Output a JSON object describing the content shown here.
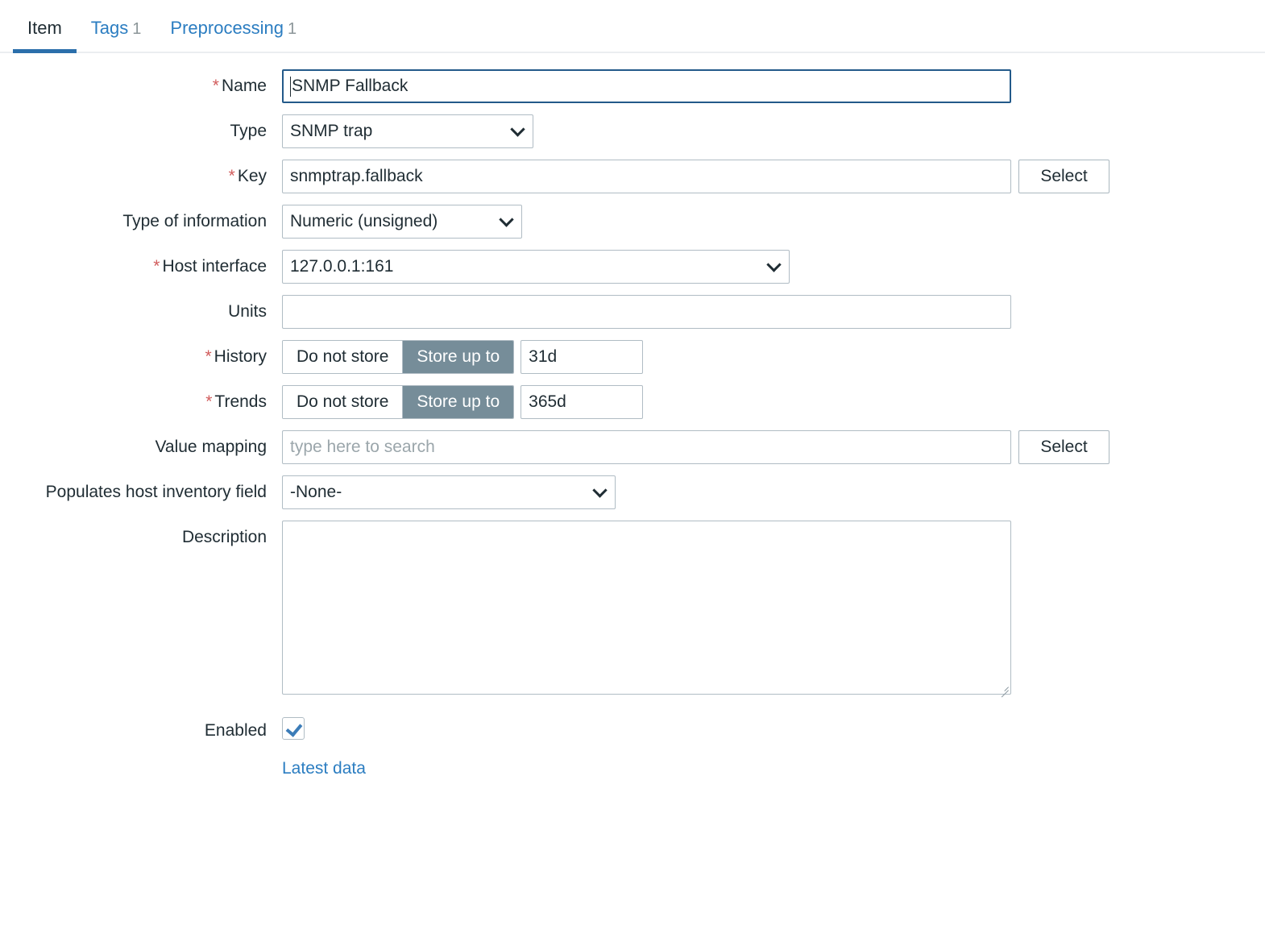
{
  "tabs": [
    {
      "label": "Item",
      "count": "",
      "active": true
    },
    {
      "label": "Tags",
      "count": "1",
      "active": false
    },
    {
      "label": "Preprocessing",
      "count": "1",
      "active": false
    }
  ],
  "form": {
    "name": {
      "label": "Name",
      "required": "*",
      "value": "SNMP Fallback",
      "focused": true
    },
    "type": {
      "label": "Type",
      "value": "SNMP trap"
    },
    "key": {
      "label": "Key",
      "required": "*",
      "value": "snmptrap.fallback",
      "select_label": "Select"
    },
    "type_of_information": {
      "label": "Type of information",
      "value": "Numeric (unsigned)"
    },
    "host_interface": {
      "label": "Host interface",
      "required": "*",
      "value": "127.0.0.1:161"
    },
    "units": {
      "label": "Units",
      "value": ""
    },
    "history": {
      "label": "History",
      "required": "*",
      "opt_off": "Do not store",
      "opt_on": "Store up to",
      "selected": "Store up to",
      "value": "31d"
    },
    "trends": {
      "label": "Trends",
      "required": "*",
      "opt_off": "Do not store",
      "opt_on": "Store up to",
      "selected": "Store up to",
      "value": "365d"
    },
    "value_mapping": {
      "label": "Value mapping",
      "value": "",
      "placeholder": "type here to search",
      "select_label": "Select"
    },
    "inventory_field": {
      "label": "Populates host inventory field",
      "value": "-None-"
    },
    "description": {
      "label": "Description",
      "value": ""
    },
    "enabled": {
      "label": "Enabled",
      "checked": true
    },
    "latest_data_link": "Latest data"
  },
  "colors": {
    "accent_blue": "#2b7dc1",
    "tab_underline": "#2b6fab",
    "focus_border": "#235a8a",
    "segment_selected": "#768d99",
    "required_asterisk": "#d15c5c",
    "border": "#b0bcc4",
    "text": "#1f2c33",
    "placeholder": "#9ba6ab"
  }
}
